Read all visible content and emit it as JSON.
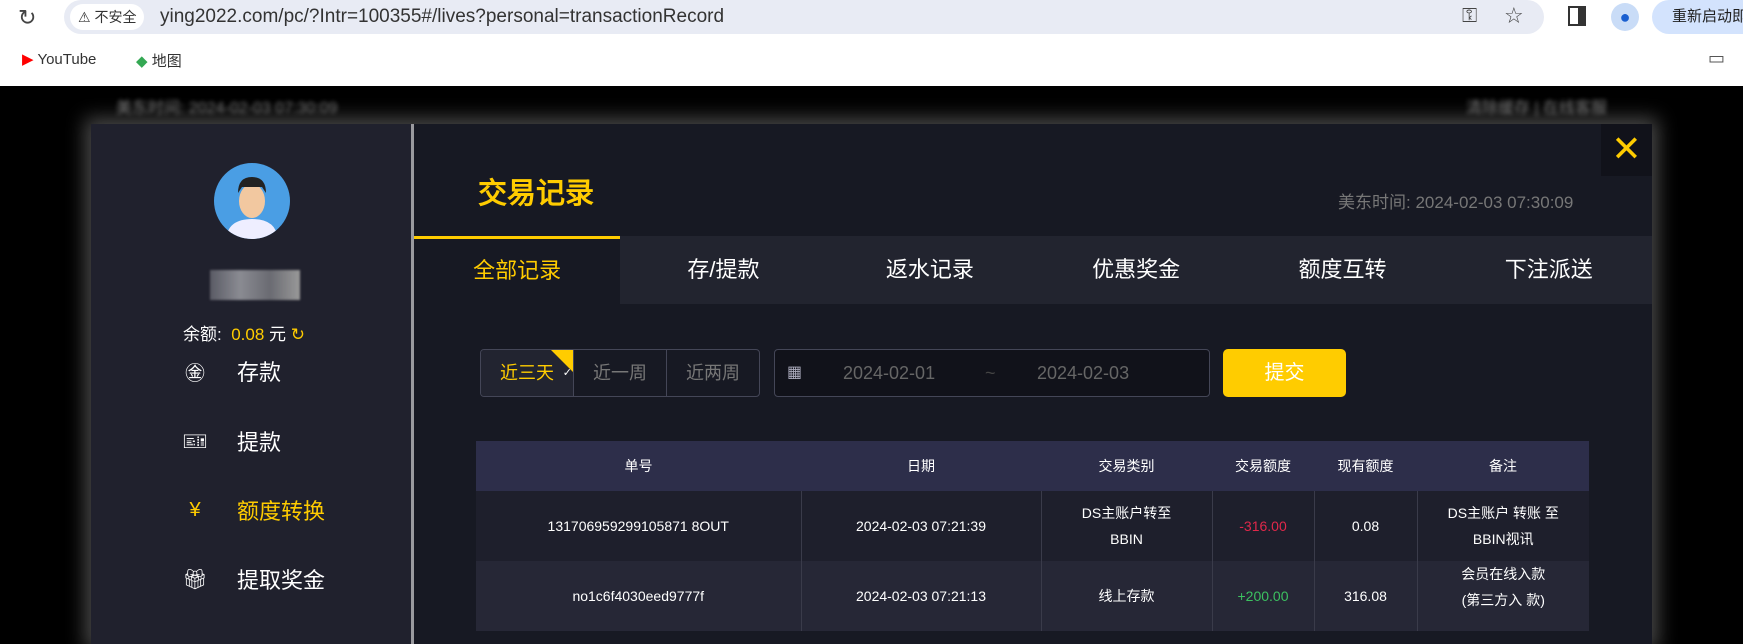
{
  "browser": {
    "security_label": "不安全",
    "url": "ying2022.com/pc/?Intr=100355#/lives?personal=transactionRecord",
    "relaunch_label": "重新启动即",
    "bookmarks": [
      {
        "label": "YouTube"
      },
      {
        "label": "地图"
      }
    ]
  },
  "background": {
    "left_text": "美东时间: 2024-02-03 07:30:09",
    "right_text": "清除缓存 | 在线客服"
  },
  "sidebar": {
    "balance_label": "余额:",
    "balance_value": "0.08",
    "balance_unit": "元",
    "menu": [
      {
        "label": "存款",
        "icon": "deposit-icon"
      },
      {
        "label": "提款",
        "icon": "withdraw-icon"
      },
      {
        "label": "额度转换",
        "icon": "transfer-icon",
        "active": true
      },
      {
        "label": "提取奖金",
        "icon": "gift-icon"
      }
    ]
  },
  "main": {
    "title": "交易记录",
    "time_label": "美东时间:",
    "time_value": "2024-02-03 07:30:09",
    "tabs": [
      {
        "label": "全部记录"
      },
      {
        "label": "存/提款"
      },
      {
        "label": "返水记录"
      },
      {
        "label": "优惠奖金"
      },
      {
        "label": "额度互转"
      },
      {
        "label": "下注派送"
      }
    ],
    "filter": {
      "ranges": [
        {
          "label": "近三天"
        },
        {
          "label": "近一周"
        },
        {
          "label": "近两周"
        }
      ],
      "start_date": "2024-02-01",
      "separator": "~",
      "end_date": "2024-02-03",
      "submit_label": "提交"
    },
    "table": {
      "headers": [
        "单号",
        "日期",
        "交易类别",
        "交易额度",
        "现有额度",
        "备注"
      ],
      "rows": [
        {
          "id": "131706959299105871 8OUT",
          "date": "2024-02-03 07:21:39",
          "type": "DS主账户转至 BBIN",
          "amount": "-316.00",
          "balance": "0.08",
          "note": "DS主账户 转账 至 BBIN视讯"
        },
        {
          "id": "no1c6f4030eed9777f",
          "date": "2024-02-03 07:21:13",
          "type": "线上存款",
          "amount": "+200.00",
          "balance": "316.08",
          "note": "会员在线入款 (第三方入 款)"
        }
      ]
    }
  },
  "colors": {
    "accent": "#ffcc00",
    "negative": "#e0284a",
    "positive": "#3cc060"
  }
}
